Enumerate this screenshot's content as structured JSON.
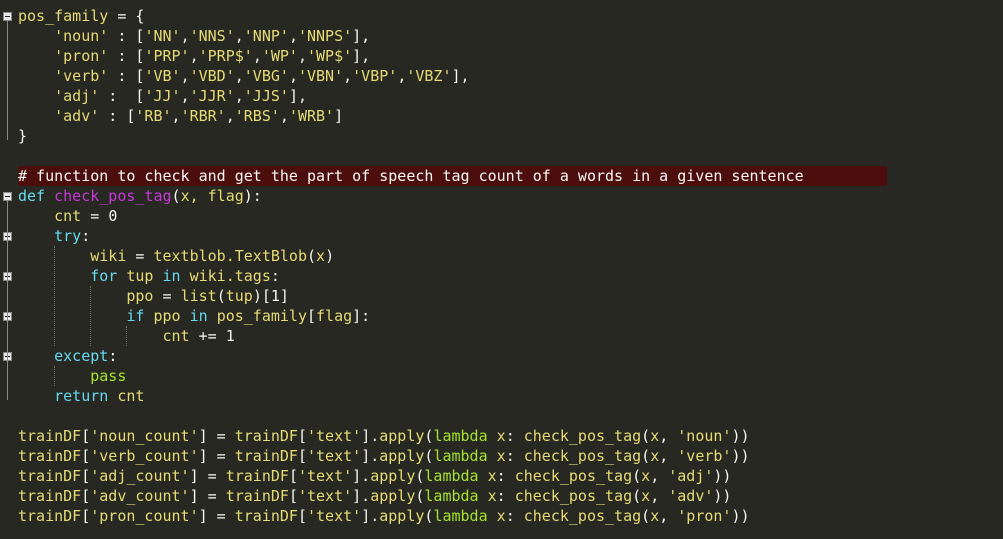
{
  "editor": {
    "lines": [
      [
        {
          "t": "pos_family",
          "c": "id"
        },
        {
          "t": " = {",
          "c": "tx"
        }
      ],
      [
        {
          "t": "    ",
          "c": "tx"
        },
        {
          "t": "'noun'",
          "c": "str"
        },
        {
          "t": " : [",
          "c": "tx"
        },
        {
          "t": "'NN'",
          "c": "str"
        },
        {
          "t": ",",
          "c": "tx"
        },
        {
          "t": "'NNS'",
          "c": "str"
        },
        {
          "t": ",",
          "c": "tx"
        },
        {
          "t": "'NNP'",
          "c": "str"
        },
        {
          "t": ",",
          "c": "tx"
        },
        {
          "t": "'NNPS'",
          "c": "str"
        },
        {
          "t": "],",
          "c": "tx"
        }
      ],
      [
        {
          "t": "    ",
          "c": "tx"
        },
        {
          "t": "'pron'",
          "c": "str"
        },
        {
          "t": " : [",
          "c": "tx"
        },
        {
          "t": "'PRP'",
          "c": "str"
        },
        {
          "t": ",",
          "c": "tx"
        },
        {
          "t": "'PRP$'",
          "c": "str"
        },
        {
          "t": ",",
          "c": "tx"
        },
        {
          "t": "'WP'",
          "c": "str"
        },
        {
          "t": ",",
          "c": "tx"
        },
        {
          "t": "'WP$'",
          "c": "str"
        },
        {
          "t": "],",
          "c": "tx"
        }
      ],
      [
        {
          "t": "    ",
          "c": "tx"
        },
        {
          "t": "'verb'",
          "c": "str"
        },
        {
          "t": " : [",
          "c": "tx"
        },
        {
          "t": "'VB'",
          "c": "str"
        },
        {
          "t": ",",
          "c": "tx"
        },
        {
          "t": "'VBD'",
          "c": "str"
        },
        {
          "t": ",",
          "c": "tx"
        },
        {
          "t": "'VBG'",
          "c": "str"
        },
        {
          "t": ",",
          "c": "tx"
        },
        {
          "t": "'VBN'",
          "c": "str"
        },
        {
          "t": ",",
          "c": "tx"
        },
        {
          "t": "'VBP'",
          "c": "str"
        },
        {
          "t": ",",
          "c": "tx"
        },
        {
          "t": "'VBZ'",
          "c": "str"
        },
        {
          "t": "],",
          "c": "tx"
        }
      ],
      [
        {
          "t": "    ",
          "c": "tx"
        },
        {
          "t": "'adj'",
          "c": "str"
        },
        {
          "t": " :  [",
          "c": "tx"
        },
        {
          "t": "'JJ'",
          "c": "str"
        },
        {
          "t": ",",
          "c": "tx"
        },
        {
          "t": "'JJR'",
          "c": "str"
        },
        {
          "t": ",",
          "c": "tx"
        },
        {
          "t": "'JJS'",
          "c": "str"
        },
        {
          "t": "],",
          "c": "tx"
        }
      ],
      [
        {
          "t": "    ",
          "c": "tx"
        },
        {
          "t": "'adv'",
          "c": "str"
        },
        {
          "t": " : [",
          "c": "tx"
        },
        {
          "t": "'RB'",
          "c": "str"
        },
        {
          "t": ",",
          "c": "tx"
        },
        {
          "t": "'RBR'",
          "c": "str"
        },
        {
          "t": ",",
          "c": "tx"
        },
        {
          "t": "'RBS'",
          "c": "str"
        },
        {
          "t": ",",
          "c": "tx"
        },
        {
          "t": "'WRB'",
          "c": "str"
        },
        {
          "t": "]",
          "c": "tx"
        }
      ],
      [
        {
          "t": "}",
          "c": "tx"
        }
      ],
      [
        {
          "t": "",
          "c": "tx"
        }
      ],
      [
        {
          "t": "# function to check and get the part of speech tag count of a words in a given sentence",
          "c": "cm"
        }
      ],
      [
        {
          "t": "def",
          "c": "kw"
        },
        {
          "t": " ",
          "c": "tx"
        },
        {
          "t": "check_pos_tag",
          "c": "fn"
        },
        {
          "t": "(",
          "c": "tx"
        },
        {
          "t": "x, flag",
          "c": "id"
        },
        {
          "t": "):",
          "c": "tx"
        }
      ],
      [
        {
          "t": "    ",
          "c": "tx"
        },
        {
          "t": "cnt",
          "c": "id"
        },
        {
          "t": " = ",
          "c": "tx"
        },
        {
          "t": "0",
          "c": "num"
        }
      ],
      [
        {
          "t": "    ",
          "c": "tx"
        },
        {
          "t": "try",
          "c": "kw"
        },
        {
          "t": ":",
          "c": "tx"
        }
      ],
      [
        {
          "t": "        ",
          "c": "tx"
        },
        {
          "t": "wiki",
          "c": "id"
        },
        {
          "t": " = ",
          "c": "tx"
        },
        {
          "t": "textblob.TextBlob",
          "c": "id"
        },
        {
          "t": "(",
          "c": "tx"
        },
        {
          "t": "x",
          "c": "id"
        },
        {
          "t": ")",
          "c": "tx"
        }
      ],
      [
        {
          "t": "        ",
          "c": "tx"
        },
        {
          "t": "for",
          "c": "kw"
        },
        {
          "t": " ",
          "c": "tx"
        },
        {
          "t": "tup",
          "c": "id"
        },
        {
          "t": " ",
          "c": "tx"
        },
        {
          "t": "in",
          "c": "kw"
        },
        {
          "t": " ",
          "c": "tx"
        },
        {
          "t": "wiki.tags",
          "c": "id"
        },
        {
          "t": ":",
          "c": "tx"
        }
      ],
      [
        {
          "t": "            ",
          "c": "tx"
        },
        {
          "t": "ppo",
          "c": "id"
        },
        {
          "t": " = ",
          "c": "tx"
        },
        {
          "t": "list",
          "c": "id"
        },
        {
          "t": "(",
          "c": "tx"
        },
        {
          "t": "tup",
          "c": "id"
        },
        {
          "t": ")[",
          "c": "tx"
        },
        {
          "t": "1",
          "c": "num"
        },
        {
          "t": "]",
          "c": "tx"
        }
      ],
      [
        {
          "t": "            ",
          "c": "tx"
        },
        {
          "t": "if",
          "c": "kw"
        },
        {
          "t": " ",
          "c": "tx"
        },
        {
          "t": "ppo",
          "c": "id"
        },
        {
          "t": " ",
          "c": "tx"
        },
        {
          "t": "in",
          "c": "kw"
        },
        {
          "t": " ",
          "c": "tx"
        },
        {
          "t": "pos_family",
          "c": "id"
        },
        {
          "t": "[",
          "c": "tx"
        },
        {
          "t": "flag",
          "c": "id"
        },
        {
          "t": "]:",
          "c": "tx"
        }
      ],
      [
        {
          "t": "                ",
          "c": "tx"
        },
        {
          "t": "cnt",
          "c": "id"
        },
        {
          "t": " += ",
          "c": "tx"
        },
        {
          "t": "1",
          "c": "num"
        }
      ],
      [
        {
          "t": "    ",
          "c": "tx"
        },
        {
          "t": "except",
          "c": "kw"
        },
        {
          "t": ":",
          "c": "tx"
        }
      ],
      [
        {
          "t": "        ",
          "c": "tx"
        },
        {
          "t": "pass",
          "c": "lam"
        }
      ],
      [
        {
          "t": "    ",
          "c": "tx"
        },
        {
          "t": "return",
          "c": "kw"
        },
        {
          "t": " ",
          "c": "tx"
        },
        {
          "t": "cnt",
          "c": "id"
        }
      ],
      [
        {
          "t": "",
          "c": "tx"
        }
      ],
      [
        {
          "t": "trainDF",
          "c": "id"
        },
        {
          "t": "[",
          "c": "tx"
        },
        {
          "t": "'noun_count'",
          "c": "str"
        },
        {
          "t": "] = ",
          "c": "tx"
        },
        {
          "t": "trainDF",
          "c": "id"
        },
        {
          "t": "[",
          "c": "tx"
        },
        {
          "t": "'text'",
          "c": "str"
        },
        {
          "t": "].",
          "c": "tx"
        },
        {
          "t": "apply",
          "c": "id"
        },
        {
          "t": "(",
          "c": "tx"
        },
        {
          "t": "lambda",
          "c": "lam"
        },
        {
          "t": " ",
          "c": "tx"
        },
        {
          "t": "x",
          "c": "id"
        },
        {
          "t": ": ",
          "c": "tx"
        },
        {
          "t": "check_pos_tag",
          "c": "id"
        },
        {
          "t": "(",
          "c": "tx"
        },
        {
          "t": "x",
          "c": "id"
        },
        {
          "t": ", ",
          "c": "tx"
        },
        {
          "t": "'noun'",
          "c": "str"
        },
        {
          "t": "))",
          "c": "tx"
        }
      ],
      [
        {
          "t": "trainDF",
          "c": "id"
        },
        {
          "t": "[",
          "c": "tx"
        },
        {
          "t": "'verb_count'",
          "c": "str"
        },
        {
          "t": "] = ",
          "c": "tx"
        },
        {
          "t": "trainDF",
          "c": "id"
        },
        {
          "t": "[",
          "c": "tx"
        },
        {
          "t": "'text'",
          "c": "str"
        },
        {
          "t": "].",
          "c": "tx"
        },
        {
          "t": "apply",
          "c": "id"
        },
        {
          "t": "(",
          "c": "tx"
        },
        {
          "t": "lambda",
          "c": "lam"
        },
        {
          "t": " ",
          "c": "tx"
        },
        {
          "t": "x",
          "c": "id"
        },
        {
          "t": ": ",
          "c": "tx"
        },
        {
          "t": "check_pos_tag",
          "c": "id"
        },
        {
          "t": "(",
          "c": "tx"
        },
        {
          "t": "x",
          "c": "id"
        },
        {
          "t": ", ",
          "c": "tx"
        },
        {
          "t": "'verb'",
          "c": "str"
        },
        {
          "t": "))",
          "c": "tx"
        }
      ],
      [
        {
          "t": "trainDF",
          "c": "id"
        },
        {
          "t": "[",
          "c": "tx"
        },
        {
          "t": "'adj_count'",
          "c": "str"
        },
        {
          "t": "] = ",
          "c": "tx"
        },
        {
          "t": "trainDF",
          "c": "id"
        },
        {
          "t": "[",
          "c": "tx"
        },
        {
          "t": "'text'",
          "c": "str"
        },
        {
          "t": "].",
          "c": "tx"
        },
        {
          "t": "apply",
          "c": "id"
        },
        {
          "t": "(",
          "c": "tx"
        },
        {
          "t": "lambda",
          "c": "lam"
        },
        {
          "t": " ",
          "c": "tx"
        },
        {
          "t": "x",
          "c": "id"
        },
        {
          "t": ": ",
          "c": "tx"
        },
        {
          "t": "check_pos_tag",
          "c": "id"
        },
        {
          "t": "(",
          "c": "tx"
        },
        {
          "t": "x",
          "c": "id"
        },
        {
          "t": ", ",
          "c": "tx"
        },
        {
          "t": "'adj'",
          "c": "str"
        },
        {
          "t": "))",
          "c": "tx"
        }
      ],
      [
        {
          "t": "trainDF",
          "c": "id"
        },
        {
          "t": "[",
          "c": "tx"
        },
        {
          "t": "'adv_count'",
          "c": "str"
        },
        {
          "t": "] = ",
          "c": "tx"
        },
        {
          "t": "trainDF",
          "c": "id"
        },
        {
          "t": "[",
          "c": "tx"
        },
        {
          "t": "'text'",
          "c": "str"
        },
        {
          "t": "].",
          "c": "tx"
        },
        {
          "t": "apply",
          "c": "id"
        },
        {
          "t": "(",
          "c": "tx"
        },
        {
          "t": "lambda",
          "c": "lam"
        },
        {
          "t": " ",
          "c": "tx"
        },
        {
          "t": "x",
          "c": "id"
        },
        {
          "t": ": ",
          "c": "tx"
        },
        {
          "t": "check_pos_tag",
          "c": "id"
        },
        {
          "t": "(",
          "c": "tx"
        },
        {
          "t": "x",
          "c": "id"
        },
        {
          "t": ", ",
          "c": "tx"
        },
        {
          "t": "'adv'",
          "c": "str"
        },
        {
          "t": "))",
          "c": "tx"
        }
      ],
      [
        {
          "t": "trainDF",
          "c": "id"
        },
        {
          "t": "[",
          "c": "tx"
        },
        {
          "t": "'pron_count'",
          "c": "str"
        },
        {
          "t": "] = ",
          "c": "tx"
        },
        {
          "t": "trainDF",
          "c": "id"
        },
        {
          "t": "[",
          "c": "tx"
        },
        {
          "t": "'text'",
          "c": "str"
        },
        {
          "t": "].",
          "c": "tx"
        },
        {
          "t": "apply",
          "c": "id"
        },
        {
          "t": "(",
          "c": "tx"
        },
        {
          "t": "lambda",
          "c": "lam"
        },
        {
          "t": " ",
          "c": "tx"
        },
        {
          "t": "x",
          "c": "id"
        },
        {
          "t": ": ",
          "c": "tx"
        },
        {
          "t": "check_pos_tag",
          "c": "id"
        },
        {
          "t": "(",
          "c": "tx"
        },
        {
          "t": "x",
          "c": "id"
        },
        {
          "t": ", ",
          "c": "tx"
        },
        {
          "t": "'pron'",
          "c": "str"
        },
        {
          "t": "))",
          "c": "tx"
        }
      ]
    ],
    "highlighted_line": 8,
    "fold_markers": [
      0,
      9,
      11,
      13,
      15,
      17
    ],
    "colors": {
      "background": "#272822",
      "highlight": "#4c0d0d",
      "keyword": "#66d9ef",
      "function_name": "#c837d8",
      "identifier": "#e6db74",
      "string": "#e6db74",
      "builtin": "#a6e22e",
      "text": "#f8f8f2"
    }
  }
}
